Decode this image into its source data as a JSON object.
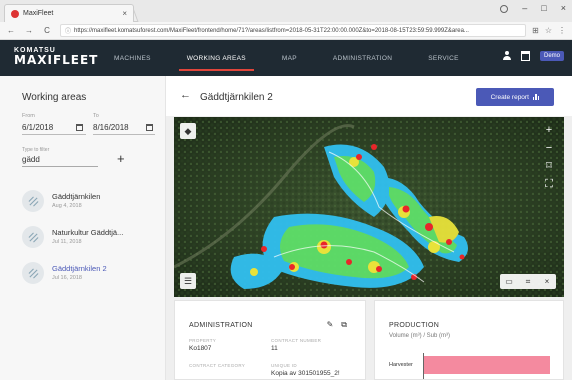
{
  "browser": {
    "tab_title": "MaxiFleet",
    "url_secure": "Secure",
    "url": "https://maxifleet.komatsuforest.com/MaxiFleet/frontend/home/71?/areas/listfrom=2018-05-31T22:00:00.000Z&to=2018-08-15T23:59:59.999Z&area..."
  },
  "header": {
    "logo_top": "KOMATSU",
    "logo_main": "MAXIFLEET",
    "nav": [
      "MACHINES",
      "WORKING AREAS",
      "MAP",
      "ADMINISTRATION",
      "SERVICE"
    ],
    "active_nav": "WORKING AREAS",
    "demo_label": "Demo"
  },
  "sidebar": {
    "title": "Working areas",
    "from_label": "From",
    "from_value": "6/1/2018",
    "to_label": "To",
    "to_value": "8/16/2018",
    "filter_label": "Type to filter",
    "filter_value": "gädd",
    "items": [
      {
        "name": "Gäddtjärnkilen",
        "date": "Aug 4, 2018"
      },
      {
        "name": "Naturkultur Gäddtjä...",
        "date": "Jul 11, 2018"
      },
      {
        "name": "Gäddtjärnkilen 2",
        "date": "Jul 16, 2018"
      }
    ]
  },
  "main": {
    "title": "Gäddtjärnkilen 2",
    "create_report_label": "Create report"
  },
  "admin": {
    "title": "ADMINISTRATION",
    "property_label": "PROPERTY",
    "property_value": "Ko1807",
    "contract_number_label": "CONTRACT NUMBER",
    "contract_number_value": "11",
    "contract_category_label": "CONTRACT CATEGORY",
    "unique_id_label": "UNIQUE ID",
    "unique_id_value": "Kopia av 301501955_2!"
  },
  "production": {
    "title": "PRODUCTION",
    "subtitle": "Volume (m³) / Sub (m³)",
    "category": "Harvester",
    "bar_fraction": 0.95
  },
  "colors": {
    "header_bg": "#1f2a33",
    "accent": "#e0453b",
    "primary": "#4b59b7",
    "bar": "#f48a9f"
  }
}
